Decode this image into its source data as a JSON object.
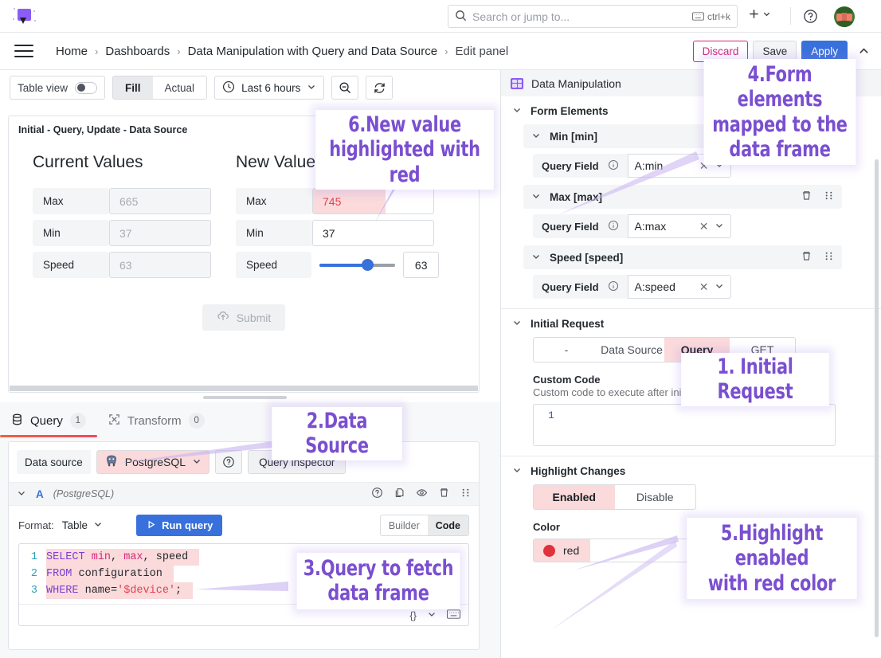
{
  "topbar": {
    "search_placeholder": "Search or jump to...",
    "search_shortcut": "ctrl+k",
    "logo_name": "grafana-logo"
  },
  "breadcrumb": {
    "items": [
      "Home",
      "Dashboards",
      "Data Manipulation with Query and Data Source",
      "Edit panel"
    ],
    "separator": "›"
  },
  "edit_actions": {
    "discard": "Discard",
    "save": "Save",
    "apply": "Apply"
  },
  "panel_toolbar": {
    "table_view_label": "Table view",
    "fill_label": "Fill",
    "actual_label": "Actual",
    "time_range": "Last 6 hours"
  },
  "panel": {
    "title": "Initial - Query, Update - Data Source",
    "current_heading": "Current Values",
    "new_heading": "New Values",
    "current_rows": [
      {
        "label": "Max",
        "value": "665"
      },
      {
        "label": "Min",
        "value": "37"
      },
      {
        "label": "Speed",
        "value": "63"
      }
    ],
    "new_rows": [
      {
        "label": "Max",
        "value": "745"
      },
      {
        "label": "Min",
        "value": "37"
      },
      {
        "label": "Speed",
        "value": "63"
      }
    ],
    "submit_label": "Submit"
  },
  "query_tabs": [
    {
      "label": "Query",
      "count": "1"
    },
    {
      "label": "Transform",
      "count": "0"
    }
  ],
  "query_editor": {
    "data_source_label": "Data source",
    "data_source_name": "PostgreSQL",
    "query_inspector": "Query inspector",
    "ref_id": "A",
    "ref_ds": "(PostgreSQL)",
    "format_label": "Format:",
    "format_value": "Table",
    "run_query": "Run query",
    "builder_label": "Builder",
    "code_label": "Code",
    "sql_lines": [
      {
        "n": "1",
        "parts": [
          {
            "t": "SELECT ",
            "c": "kw"
          },
          {
            "t": "min",
            "c": "fn"
          },
          {
            "t": ", ",
            "c": "pl"
          },
          {
            "t": "max",
            "c": "fn"
          },
          {
            "t": ", speed",
            "c": "pl"
          }
        ]
      },
      {
        "n": "2",
        "parts": [
          {
            "t": "FROM ",
            "c": "kw"
          },
          {
            "t": "configuration",
            "c": "pl"
          }
        ]
      },
      {
        "n": "3",
        "parts": [
          {
            "t": "WHERE ",
            "c": "kw"
          },
          {
            "t": "name=",
            "c": "pl"
          },
          {
            "t": "'$device'",
            "c": "str"
          },
          {
            "t": ";",
            "c": "pl"
          }
        ]
      }
    ],
    "brace_hint": "{}"
  },
  "options": {
    "viz_name": "Data Manipulation",
    "sections": {
      "form_elements": "Form Elements",
      "initial_request": "Initial Request",
      "highlight_changes": "Highlight Changes"
    },
    "elements": [
      {
        "name": "Min [min]",
        "query_field_label": "Query Field",
        "query_field_value": "A:min"
      },
      {
        "name": "Max [max]",
        "query_field_label": "Query Field",
        "query_field_value": "A:max"
      },
      {
        "name": "Speed [speed]",
        "query_field_label": "Query Field",
        "query_field_value": "A:speed"
      }
    ],
    "request_options": [
      "-",
      "Data Source",
      "Query",
      "GET"
    ],
    "request_selected": "Query",
    "custom_code_label": "Custom Code",
    "custom_code_desc": "Custom code to execute after initial request.",
    "custom_code_line": "1",
    "highlight_options": [
      "Enabled",
      "Disable"
    ],
    "highlight_selected": "Enabled",
    "color_label": "Color",
    "color_value": "red",
    "color_hex": "#e0323c"
  },
  "annotations": [
    {
      "id": "a1",
      "text": "1. Initial Request"
    },
    {
      "id": "a2",
      "text": "2.Data Source"
    },
    {
      "id": "a3",
      "text": "3.Query to fetch\ndata frame"
    },
    {
      "id": "a4",
      "text": "4.Form elements\nmapped to the\ndata frame"
    },
    {
      "id": "a5",
      "text": "5.Highlight enabled\nwith red color"
    },
    {
      "id": "a6",
      "text": "6.New value\nhighlighted with red"
    }
  ]
}
